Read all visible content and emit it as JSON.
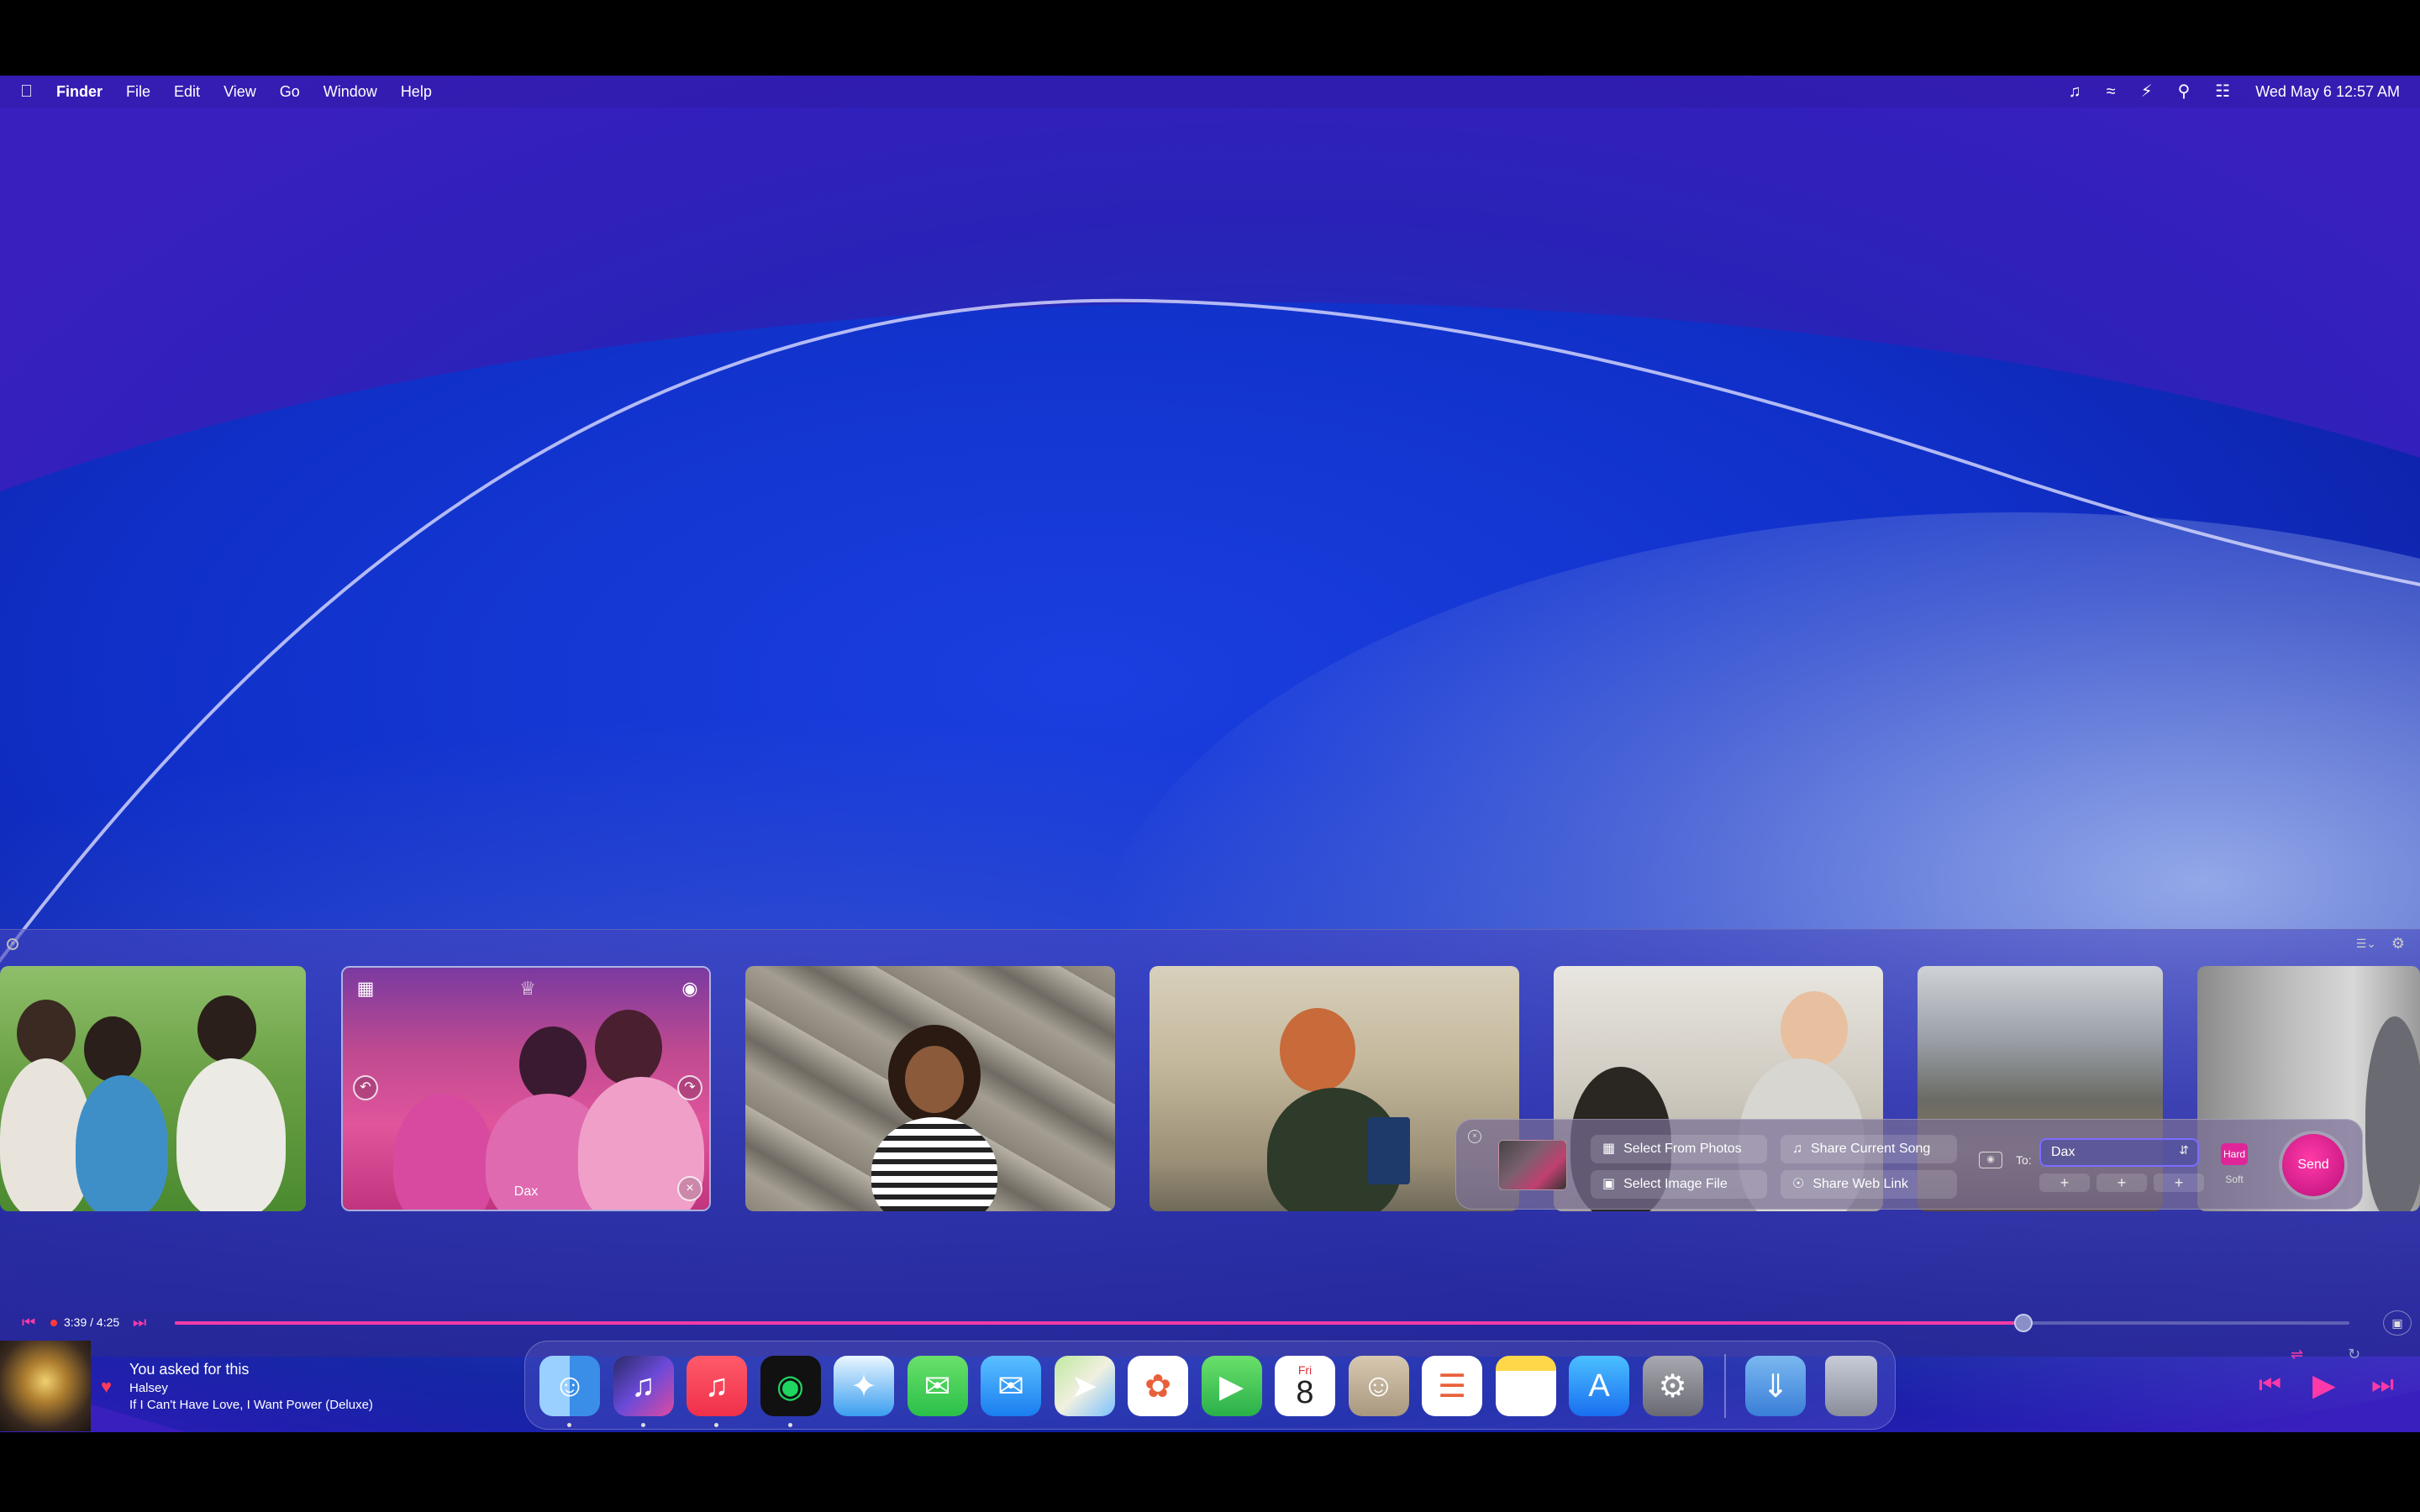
{
  "menubar": {
    "apple_icon": "apple-logo-icon",
    "app_name": "Finder",
    "menus": [
      "File",
      "Edit",
      "View",
      "Go",
      "Window",
      "Help"
    ],
    "status_icons": [
      "music-note-icon",
      "wifi-icon",
      "battery-charging-icon",
      "search-icon",
      "control-center-icon"
    ],
    "clock": "Wed May 6  12:57 AM"
  },
  "photos": {
    "selected_caption": "Dax",
    "overlay_icons": [
      "image-badge-icon",
      "trophy-icon",
      "eye-icon",
      "reply-icon",
      "forward-icon",
      "close-circle-icon"
    ]
  },
  "share": {
    "select_from_photos": "Select From Photos",
    "select_image_file": "Select Image File",
    "share_current_song": "Share Current Song",
    "share_web_link": "Share Web Link",
    "to_label": "To:",
    "recipient": "Dax",
    "hard_label": "Hard",
    "soft_label": "Soft",
    "send_label": "Send",
    "plus": "+"
  },
  "player": {
    "time": "3:39 / 4:25",
    "progress": 0.85,
    "song_title": "You asked for this",
    "artist": "Halsey",
    "album": "If I Can't Have Love, I Want Power (Deluxe)",
    "accent_color": "#ff3aa8"
  },
  "dock": {
    "apps": [
      {
        "name": "Finder",
        "icon": "finder-icon",
        "running": true
      },
      {
        "name": "Music Widget",
        "icon": "music-widget-icon",
        "running": true
      },
      {
        "name": "Music",
        "icon": "music-icon",
        "running": true
      },
      {
        "name": "Spotify",
        "icon": "spotify-icon",
        "running": true
      },
      {
        "name": "Safari",
        "icon": "safari-icon",
        "running": false
      },
      {
        "name": "Messages",
        "icon": "messages-icon",
        "running": false
      },
      {
        "name": "Mail",
        "icon": "mail-icon",
        "running": false
      },
      {
        "name": "Maps",
        "icon": "maps-icon",
        "running": false
      },
      {
        "name": "Photos",
        "icon": "photos-icon",
        "running": false
      },
      {
        "name": "FaceTime",
        "icon": "facetime-icon",
        "running": false
      },
      {
        "name": "Calendar",
        "icon": "calendar-icon",
        "running": false
      },
      {
        "name": "Contacts",
        "icon": "contacts-icon",
        "running": false
      },
      {
        "name": "Reminders",
        "icon": "reminders-icon",
        "running": false
      },
      {
        "name": "Notes",
        "icon": "notes-icon",
        "running": false
      },
      {
        "name": "App Store",
        "icon": "app-store-icon",
        "running": false
      },
      {
        "name": "System Settings",
        "icon": "settings-icon",
        "running": false
      }
    ],
    "calendar_day": "Fri",
    "calendar_date": "8",
    "downloads_icon": "downloads-folder-icon",
    "trash_icon": "trash-icon"
  }
}
